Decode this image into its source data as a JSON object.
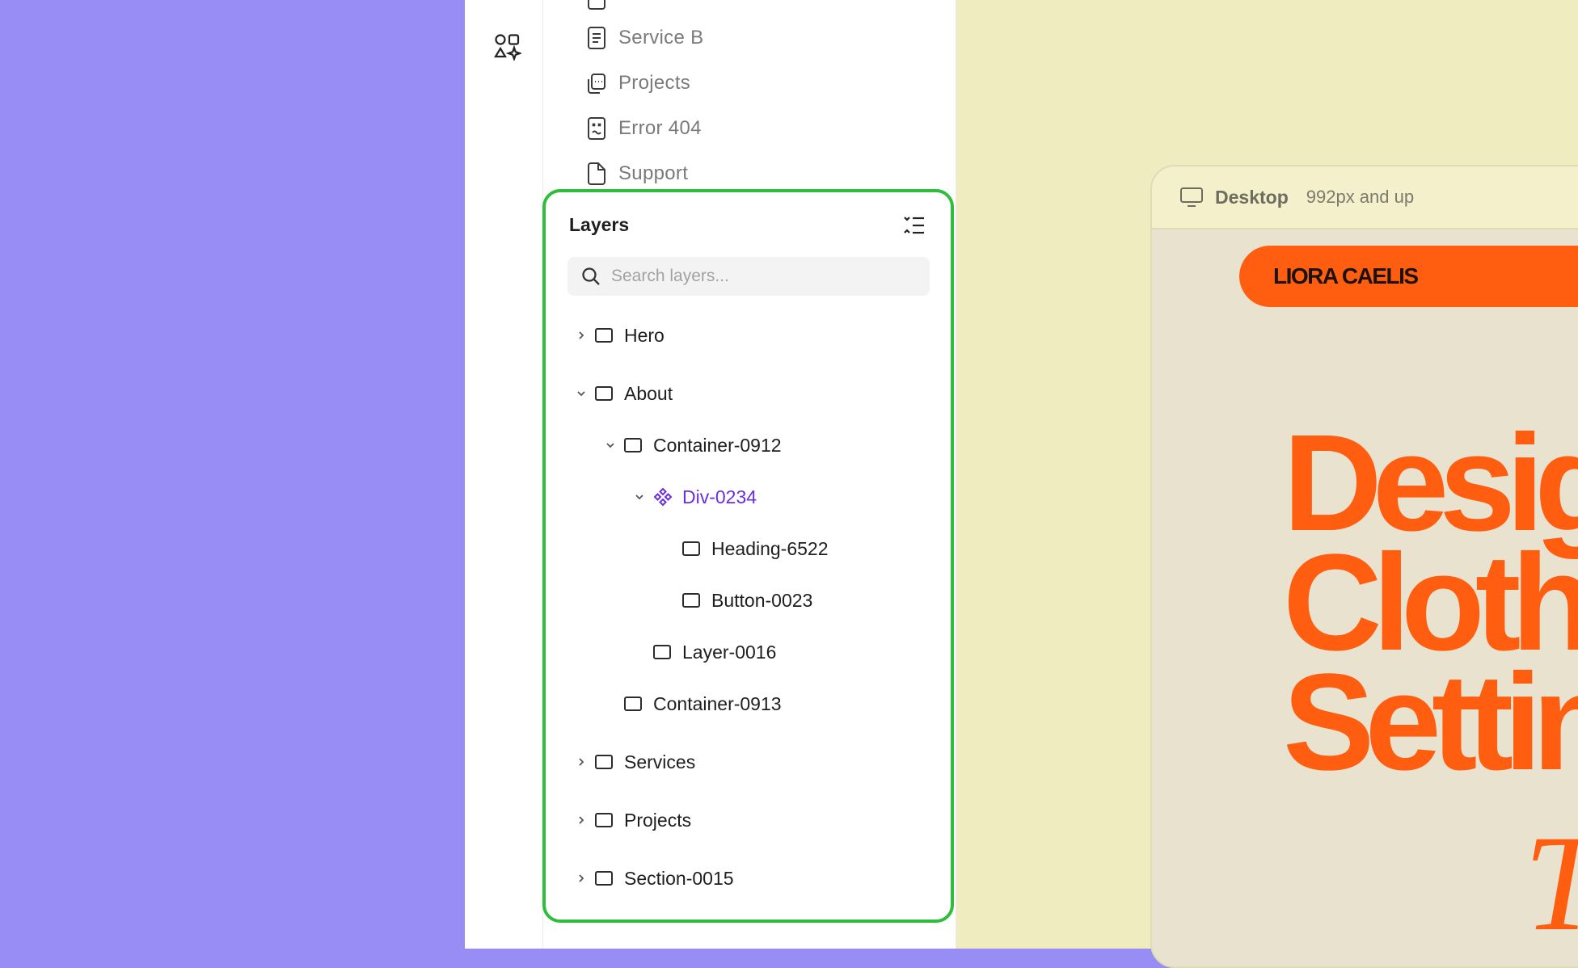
{
  "pages": [
    {
      "label": "Service B",
      "icon": "document-icon"
    },
    {
      "label": "Projects",
      "icon": "gallery-icon"
    },
    {
      "label": "Error 404",
      "icon": "error-page-icon"
    },
    {
      "label": "Support",
      "icon": "page-icon"
    }
  ],
  "layers": {
    "title": "Layers",
    "search_placeholder": "Search layers...",
    "tree": [
      {
        "label": "Hero",
        "state": "collapsed",
        "level": 0
      },
      {
        "label": "About",
        "state": "expanded",
        "level": 0
      },
      {
        "label": "Container-0912",
        "state": "expanded",
        "level": 1
      },
      {
        "label": "Div-0234",
        "state": "expanded",
        "level": 2,
        "selected": true,
        "icon": "component-icon"
      },
      {
        "label": "Heading-6522",
        "state": "leaf",
        "level": 3
      },
      {
        "label": "Button-0023",
        "state": "leaf",
        "level": 3
      },
      {
        "label": "Layer-0016",
        "state": "leaf",
        "level": 2
      },
      {
        "label": "Container-0913",
        "state": "leaf",
        "level": 1
      },
      {
        "label": "Services",
        "state": "collapsed",
        "level": 0
      },
      {
        "label": "Projects",
        "state": "collapsed",
        "level": 0
      },
      {
        "label": "Section-0015",
        "state": "collapsed",
        "level": 0
      }
    ]
  },
  "canvas": {
    "device_name": "Desktop",
    "device_range": "992px and up",
    "brand": "LIORA CAELIS",
    "hero_lines": [
      "Desig",
      "Clothe",
      "Settin"
    ],
    "hero_script": "T"
  },
  "colors": {
    "accent_orange": "#ff5e10",
    "selection_purple": "#6a2fe0",
    "highlight_green": "#2fbe3c",
    "backdrop_purple": "#978df4",
    "canvas_yellow": "#efedc0"
  }
}
